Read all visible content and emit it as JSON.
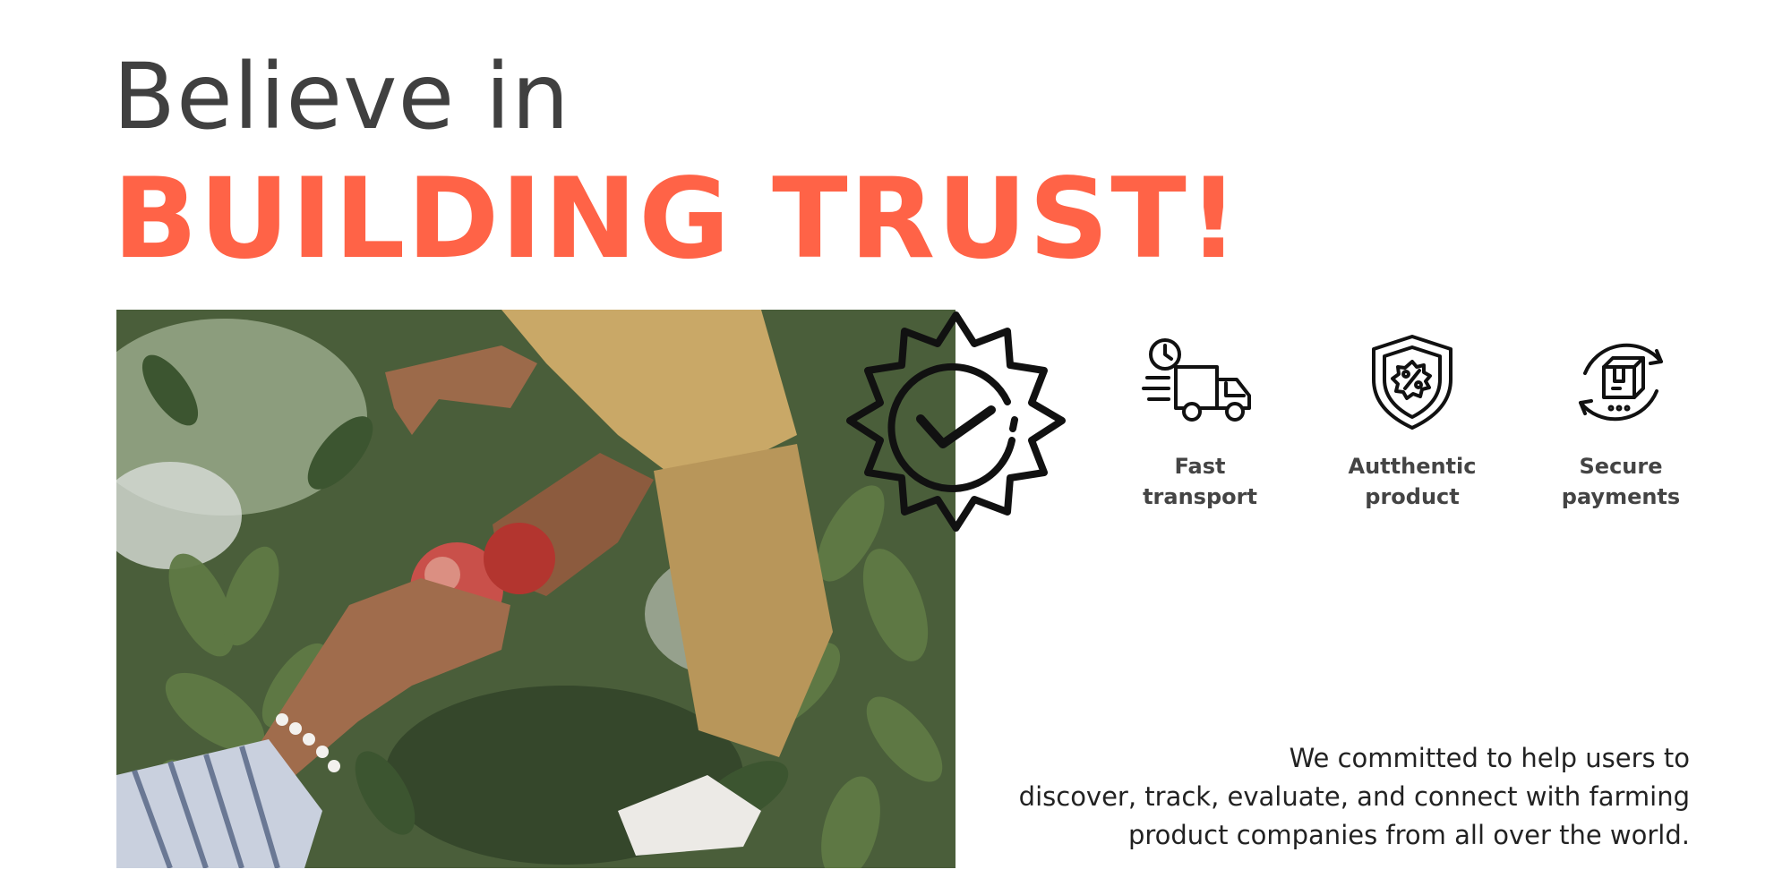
{
  "headline": {
    "line1": "Believe in",
    "line2": "BUILDING TRUST!"
  },
  "colors": {
    "accent": "#ff6347",
    "heading": "#404040",
    "body_text": "#222222"
  },
  "photo": {
    "subject": "hands passing apples among apple tree leaves"
  },
  "badge": {
    "icon": "verified-checkmark-badge-icon"
  },
  "features": [
    {
      "icon": "delivery-truck-icon",
      "label_line1": "Fast",
      "label_line2": "transport"
    },
    {
      "icon": "shield-percent-icon",
      "label_line1": "Autthentic",
      "label_line2": "product"
    },
    {
      "icon": "secure-payment-box-icon",
      "label_line1": "Secure",
      "label_line2": "payments"
    }
  ],
  "description": {
    "line1": "We committed to help users to",
    "line2": "discover, track, evaluate, and connect with farming",
    "line3": "product companies from all over the world."
  }
}
